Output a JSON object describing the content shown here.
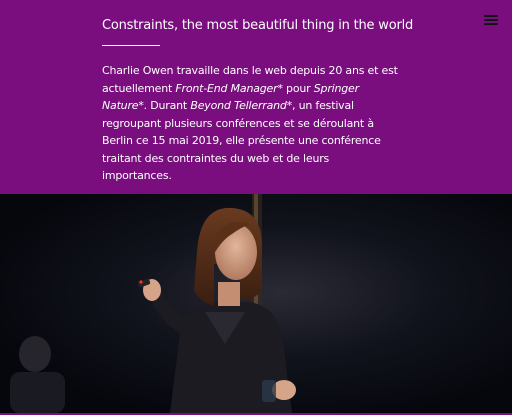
{
  "header": {
    "title": "Constraints, the most beautiful thing in the world",
    "menu_icon": "hamburger-menu-icon",
    "colors": {
      "background": "#7a0e7e",
      "text": "#ffffff"
    }
  },
  "intro": {
    "t1": "Charlie Owen travaille dans le web depuis 20 ans et est actuellement ",
    "role": "Front-End Manager*",
    "t2": " pour ",
    "company": "Springer Nature*",
    "t3": ". Durant ",
    "event": "Beyond Tellerrand*",
    "t4": ", un festival regroupant plusieurs conférences et se déroulant à Berlin ce 15 mai 2019, elle présente une conférence traitant des contraintes du web et de leurs importances."
  },
  "photo": {
    "subject": "speaker-photo"
  }
}
